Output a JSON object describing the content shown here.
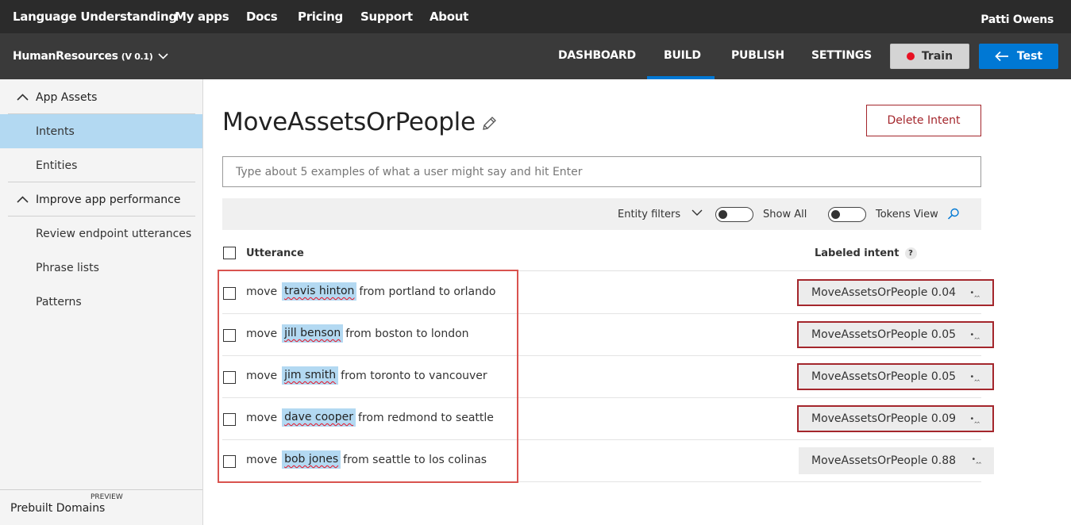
{
  "topnav": {
    "items": [
      "Language Understanding",
      "My apps",
      "Docs",
      "Pricing",
      "Support",
      "About"
    ],
    "user": "Patti Owens"
  },
  "appbar": {
    "app_name": "HumanResources",
    "version": "(V 0.1)",
    "tabs": [
      "DASHBOARD",
      "BUILD",
      "PUBLISH",
      "SETTINGS"
    ],
    "active_tab": "BUILD",
    "train_label": "Train",
    "test_label": "Test",
    "colors": {
      "train_dot": "#e81123",
      "test_bg": "#0078d4"
    }
  },
  "sidebar": {
    "sections": [
      {
        "label": "App Assets",
        "items": [
          "Intents",
          "Entities"
        ]
      },
      {
        "label": "Improve app performance",
        "items": [
          "Review endpoint utterances",
          "Phrase lists",
          "Patterns"
        ]
      }
    ],
    "active_item": "Intents",
    "bottom_badge": "PREVIEW",
    "bottom_label": "Prebuilt Domains"
  },
  "main": {
    "intent_title": "MoveAssetsOrPeople",
    "delete_label": "Delete Intent",
    "input_placeholder": "Type about 5 examples of what a user might say and hit Enter",
    "filters": {
      "entity_filters": "Entity filters",
      "show_all": "Show All",
      "tokens_view": "Tokens View"
    },
    "columns": {
      "utterance": "Utterance",
      "labeled_intent": "Labeled intent",
      "help": "?"
    },
    "rows": [
      {
        "pre": "move",
        "entity": "travis hinton",
        "post": "from portland to orlando",
        "intent": "MoveAssetsOrPeople 0.04"
      },
      {
        "pre": "move",
        "entity": "jill benson",
        "post": "from boston to london",
        "intent": "MoveAssetsOrPeople 0.05"
      },
      {
        "pre": "move",
        "entity": "jim smith",
        "post": "from toronto to vancouver",
        "intent": "MoveAssetsOrPeople 0.05"
      },
      {
        "pre": "move",
        "entity": "dave cooper",
        "post": "from redmond to seattle",
        "intent": "MoveAssetsOrPeople 0.09"
      },
      {
        "pre": "move",
        "entity": "bob jones",
        "post": "from seattle to los colinas",
        "intent": "MoveAssetsOrPeople 0.88"
      }
    ],
    "dropdown_glyph": "•‸‸"
  }
}
